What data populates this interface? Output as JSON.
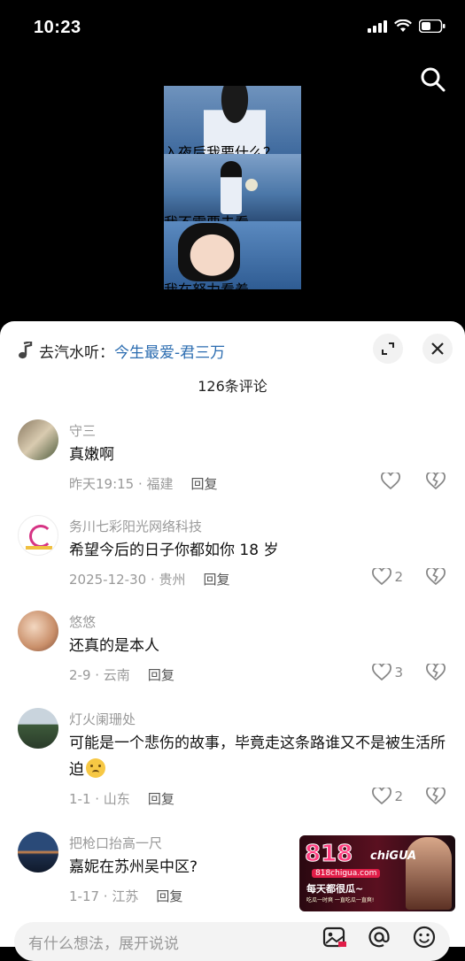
{
  "status_bar": {
    "time": "10:23"
  },
  "video": {
    "captions": [
      "入夜后我要什么？",
      "我不需要去看",
      "我在努力看着"
    ]
  },
  "sheet": {
    "music_prefix": "去汽水听：",
    "music_song": "今生最爱-君三万",
    "comment_count": "126条评论"
  },
  "comments": [
    {
      "name": "守三",
      "text": "真嫩啊",
      "time_loc": "昨天19:15 · 福建",
      "reply": "回复",
      "likes": ""
    },
    {
      "name": "务川七彩阳光网络科技",
      "text": "希望今后的日子你都如你 18 岁",
      "time_loc": "2025-12-30 · 贵州",
      "reply": "回复",
      "likes": "2"
    },
    {
      "name": "悠悠",
      "text": "还真的是本人",
      "time_loc": "2-9 · 云南",
      "reply": "回复",
      "likes": "3"
    },
    {
      "name": "灯火阑珊处",
      "text": "可能是一个悲伤的故事，毕竟走这条路谁又不是被生活所迫",
      "time_loc": "1-1 · 山东",
      "reply": "回复",
      "likes": "2"
    },
    {
      "name": "把枪口抬高一尺",
      "text": "嘉妮在苏州吴中区?",
      "time_loc": "1-17 · 江苏",
      "reply": "回复",
      "likes": ""
    }
  ],
  "ad": {
    "logo_num": "818",
    "logo_word": "chiGUA",
    "url": "818chigua.com",
    "slogan": "每天都很瓜~",
    "sub": "吃瓜一时爽 一直吃瓜一直爽!"
  },
  "input": {
    "placeholder": "有什么想法，展开说说"
  },
  "colors": {
    "link": "#2b6cb0",
    "muted": "#999999",
    "ad_pink": "#ff3d7f"
  }
}
